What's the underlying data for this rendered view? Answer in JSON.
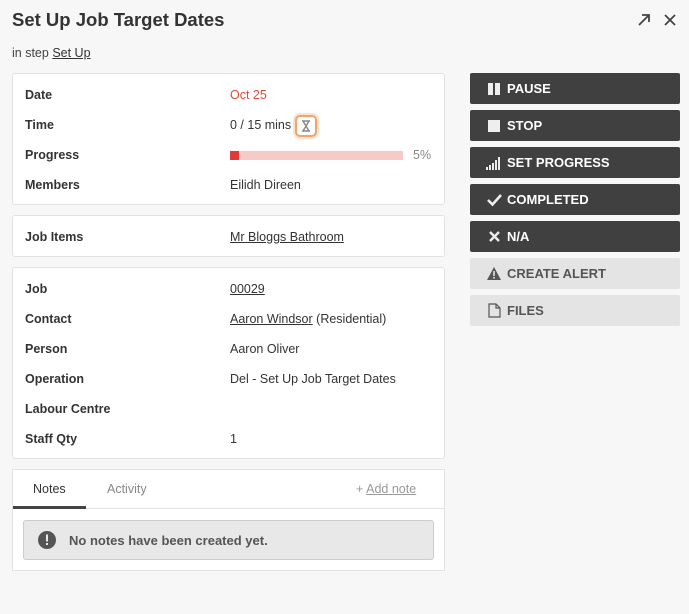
{
  "header": {
    "title": "Set Up Job Target Dates",
    "step_prefix": "in step ",
    "step_link": "Set Up"
  },
  "summary": {
    "date_label": "Date",
    "date_value": "Oct 25",
    "time_label": "Time",
    "time_value": "0 / 15 mins",
    "progress_label": "Progress",
    "progress_percent_text": "5%",
    "progress_value": 0.05,
    "members_label": "Members",
    "members_value": "Eilidh Direen"
  },
  "job_items": {
    "label": "Job Items",
    "value": "Mr Bloggs Bathroom"
  },
  "details": {
    "job_label": "Job",
    "job_value": "00029",
    "contact_label": "Contact",
    "contact_link": "Aaron Windsor",
    "contact_suffix": " (Residential)",
    "person_label": "Person",
    "person_value": "Aaron Oliver",
    "operation_label": "Operation",
    "operation_value": "Del - Set Up Job Target Dates",
    "labour_label": "Labour Centre",
    "labour_value": "",
    "staff_label": "Staff Qty",
    "staff_value": "1"
  },
  "actions": {
    "pause": "PAUSE",
    "stop": "STOP",
    "set_progress": "SET PROGRESS",
    "completed": "COMPLETED",
    "na": "N/A",
    "create_alert": "CREATE ALERT",
    "files": "FILES"
  },
  "tabs": {
    "notes": "Notes",
    "activity": "Activity",
    "add_note": "Add note",
    "empty_message": "No notes have been created yet."
  },
  "colors": {
    "accent_red": "#e04b3a",
    "progress_fill": "#e03a3a",
    "progress_track": "#f7c9c9",
    "dark_button": "#404040",
    "light_button": "#e4e4e4",
    "timer_outline": "#f0a46b"
  },
  "icons": [
    "expand-icon",
    "close-icon",
    "hourglass-icon",
    "pause-icon",
    "stop-icon",
    "signal-bars-icon",
    "checkmark-icon",
    "x-icon",
    "warning-icon",
    "file-icon",
    "plus-icon",
    "info-icon"
  ]
}
